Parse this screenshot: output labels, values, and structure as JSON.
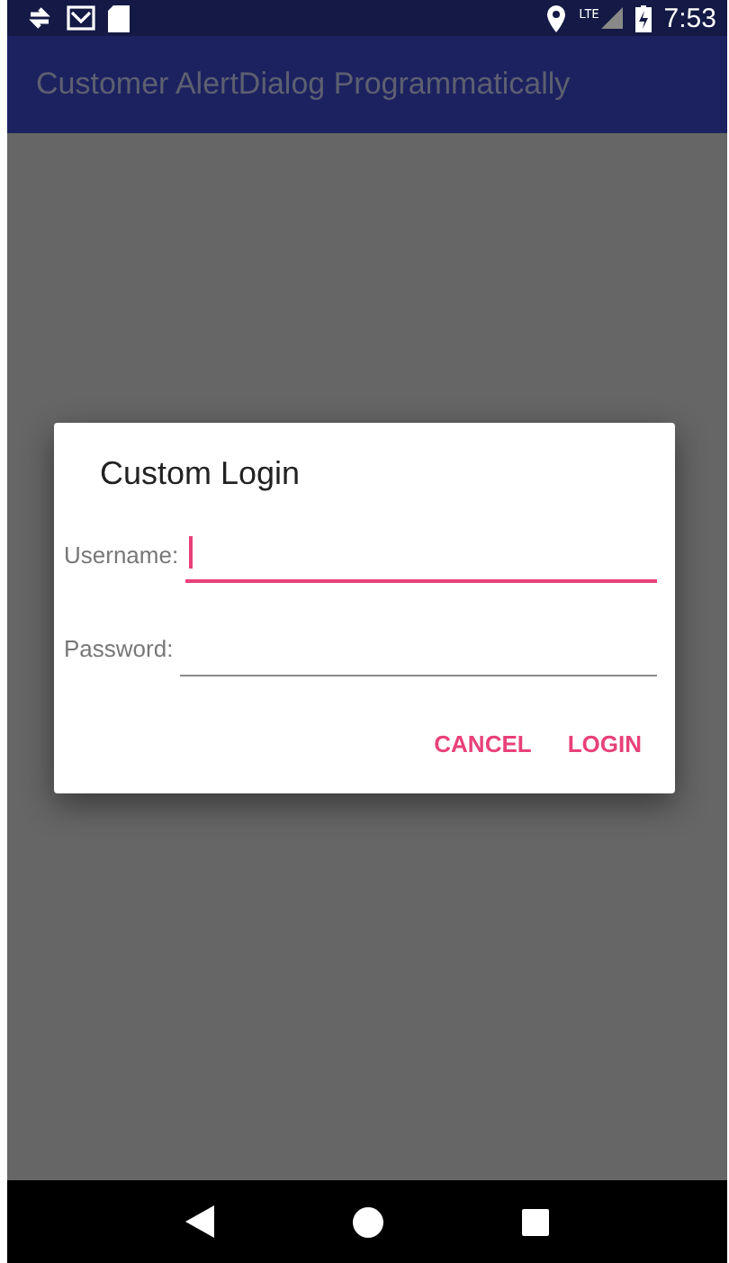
{
  "status_bar": {
    "time": "7:53",
    "network": "LTE"
  },
  "app_bar": {
    "title": "Customer AlertDialog Programmatically"
  },
  "dialog": {
    "title": "Custom Login",
    "fields": [
      {
        "label": "Username:",
        "focused": true
      },
      {
        "label": "Password:",
        "focused": false
      }
    ],
    "buttons": [
      "CANCEL",
      "LOGIN"
    ]
  }
}
